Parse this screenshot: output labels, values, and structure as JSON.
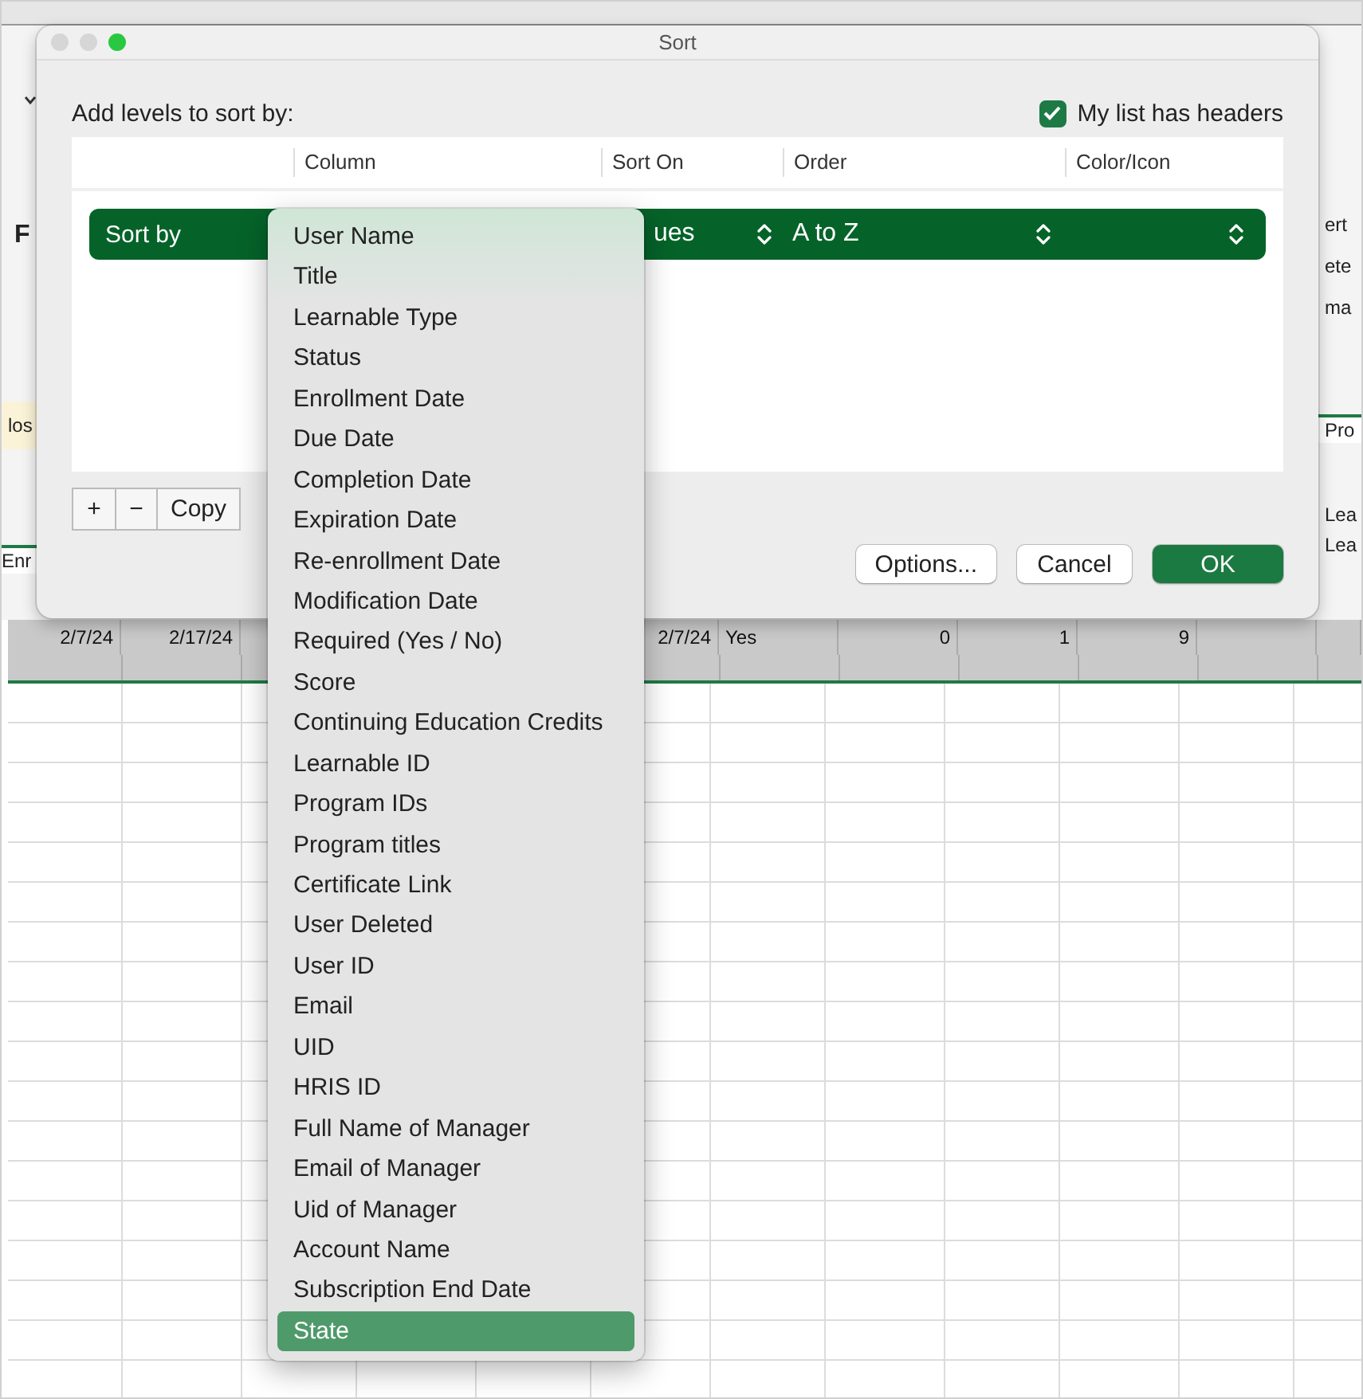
{
  "sheet": {
    "left_fragments": [
      {
        "text": "F",
        "kind": "bold"
      },
      {
        "text": "los",
        "kind": "note"
      },
      {
        "text": "Enr",
        "kind": "header"
      }
    ],
    "right_fragments": [
      {
        "text": "ert",
        "kind": "plain"
      },
      {
        "text": "ete",
        "kind": "plain"
      },
      {
        "text": "ma",
        "kind": "plain"
      },
      {
        "text": "Pro",
        "kind": "header"
      },
      {
        "text": "Lea",
        "kind": "plain"
      },
      {
        "text": "Lea",
        "kind": "plain"
      }
    ],
    "row_cells_left": [
      {
        "text": "2/7/24",
        "kind": "number"
      },
      {
        "text": "2/17/24",
        "kind": "number"
      }
    ],
    "row_cells_right": [
      {
        "text": "2/7/24",
        "kind": "number"
      },
      {
        "text": "Yes",
        "kind": "text"
      },
      {
        "text": "0",
        "kind": "number"
      },
      {
        "text": "1",
        "kind": "number"
      },
      {
        "text": "9",
        "kind": "number"
      }
    ]
  },
  "dialog": {
    "title": "Sort",
    "instruction": "Add levels to sort by:",
    "headers_checkbox": {
      "label": "My list has headers",
      "checked": true
    },
    "columns": [
      "Column",
      "Sort On",
      "Order",
      "Color/Icon"
    ],
    "levels": [
      {
        "label": "Sort by",
        "sort_on": "ues",
        "order": "A to Z"
      }
    ],
    "level_buttons": [
      "+",
      "−",
      "Copy"
    ],
    "buttons": [
      {
        "label": "Options...",
        "kind": "default"
      },
      {
        "label": "Cancel",
        "kind": "default"
      },
      {
        "label": "OK",
        "kind": "primary"
      }
    ]
  },
  "column_menu": {
    "items": [
      {
        "label": "User Name",
        "selected": false
      },
      {
        "label": "Title",
        "selected": false
      },
      {
        "label": "Learnable Type",
        "selected": false
      },
      {
        "label": "Status",
        "selected": false
      },
      {
        "label": "Enrollment Date",
        "selected": false
      },
      {
        "label": "Due Date",
        "selected": false
      },
      {
        "label": "Completion Date",
        "selected": false
      },
      {
        "label": "Expiration Date",
        "selected": false
      },
      {
        "label": "Re-enrollment Date",
        "selected": false
      },
      {
        "label": "Modification Date",
        "selected": false
      },
      {
        "label": "Required (Yes / No)",
        "selected": false
      },
      {
        "label": "Score",
        "selected": false
      },
      {
        "label": "Continuing Education Credits",
        "selected": false
      },
      {
        "label": "Learnable ID",
        "selected": false
      },
      {
        "label": "Program IDs",
        "selected": false
      },
      {
        "label": "Program titles",
        "selected": false
      },
      {
        "label": "Certificate Link",
        "selected": false
      },
      {
        "label": "User Deleted",
        "selected": false
      },
      {
        "label": "User ID",
        "selected": false
      },
      {
        "label": "Email",
        "selected": false
      },
      {
        "label": "UID",
        "selected": false
      },
      {
        "label": "HRIS ID",
        "selected": false
      },
      {
        "label": "Full Name of Manager",
        "selected": false
      },
      {
        "label": "Email of Manager",
        "selected": false
      },
      {
        "label": "Uid of Manager",
        "selected": false
      },
      {
        "label": "Account Name",
        "selected": false
      },
      {
        "label": "Subscription End Date",
        "selected": false
      },
      {
        "label": "State",
        "selected": true
      }
    ]
  }
}
